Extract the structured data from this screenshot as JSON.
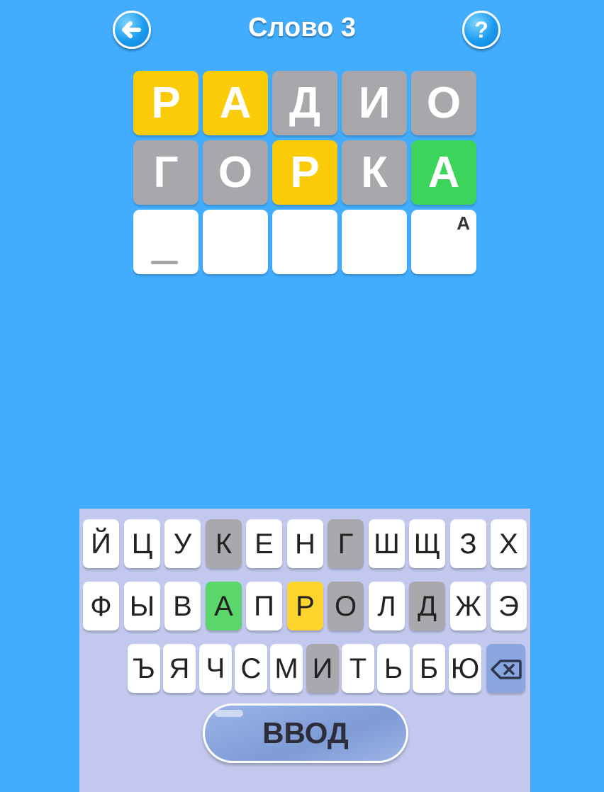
{
  "header": {
    "title": "Слово 3",
    "back_icon": "arrow-left-icon",
    "help_icon": "question-icon"
  },
  "colors": {
    "background": "#42adfe",
    "present": "#fccb07",
    "absent": "#a8a7ac",
    "correct": "#3cd45a",
    "empty": "#ffffff"
  },
  "board": {
    "rows": [
      [
        {
          "letter": "Р",
          "state": "present"
        },
        {
          "letter": "А",
          "state": "present"
        },
        {
          "letter": "Д",
          "state": "absent"
        },
        {
          "letter": "И",
          "state": "absent"
        },
        {
          "letter": "О",
          "state": "absent"
        }
      ],
      [
        {
          "letter": "Г",
          "state": "absent"
        },
        {
          "letter": "О",
          "state": "absent"
        },
        {
          "letter": "Р",
          "state": "present"
        },
        {
          "letter": "К",
          "state": "absent"
        },
        {
          "letter": "А",
          "state": "correct"
        }
      ],
      [
        {
          "letter": "",
          "state": "empty",
          "cursor": true
        },
        {
          "letter": "",
          "state": "empty"
        },
        {
          "letter": "",
          "state": "empty"
        },
        {
          "letter": "",
          "state": "empty"
        },
        {
          "letter": "",
          "state": "empty",
          "hint": "А"
        }
      ]
    ]
  },
  "keyboard": {
    "row1": [
      {
        "k": "Й",
        "s": ""
      },
      {
        "k": "Ц",
        "s": ""
      },
      {
        "k": "У",
        "s": ""
      },
      {
        "k": "К",
        "s": "gray"
      },
      {
        "k": "Е",
        "s": ""
      },
      {
        "k": "Н",
        "s": ""
      },
      {
        "k": "Г",
        "s": "gray"
      },
      {
        "k": "Ш",
        "s": ""
      },
      {
        "k": "Щ",
        "s": ""
      },
      {
        "k": "З",
        "s": ""
      },
      {
        "k": "Х",
        "s": ""
      }
    ],
    "row2": [
      {
        "k": "Ф",
        "s": ""
      },
      {
        "k": "Ы",
        "s": ""
      },
      {
        "k": "В",
        "s": ""
      },
      {
        "k": "А",
        "s": "green"
      },
      {
        "k": "П",
        "s": ""
      },
      {
        "k": "Р",
        "s": "yellow"
      },
      {
        "k": "О",
        "s": "gray"
      },
      {
        "k": "Л",
        "s": ""
      },
      {
        "k": "Д",
        "s": "gray"
      },
      {
        "k": "Ж",
        "s": ""
      },
      {
        "k": "Э",
        "s": ""
      }
    ],
    "row3": [
      {
        "k": "Ъ",
        "s": ""
      },
      {
        "k": "Я",
        "s": ""
      },
      {
        "k": "Ч",
        "s": ""
      },
      {
        "k": "С",
        "s": ""
      },
      {
        "k": "М",
        "s": ""
      },
      {
        "k": "И",
        "s": "gray"
      },
      {
        "k": "Т",
        "s": ""
      },
      {
        "k": "Ь",
        "s": ""
      },
      {
        "k": "Б",
        "s": ""
      },
      {
        "k": "Ю",
        "s": ""
      }
    ],
    "backspace_icon": "backspace-icon",
    "enter_label": "ВВОД"
  }
}
